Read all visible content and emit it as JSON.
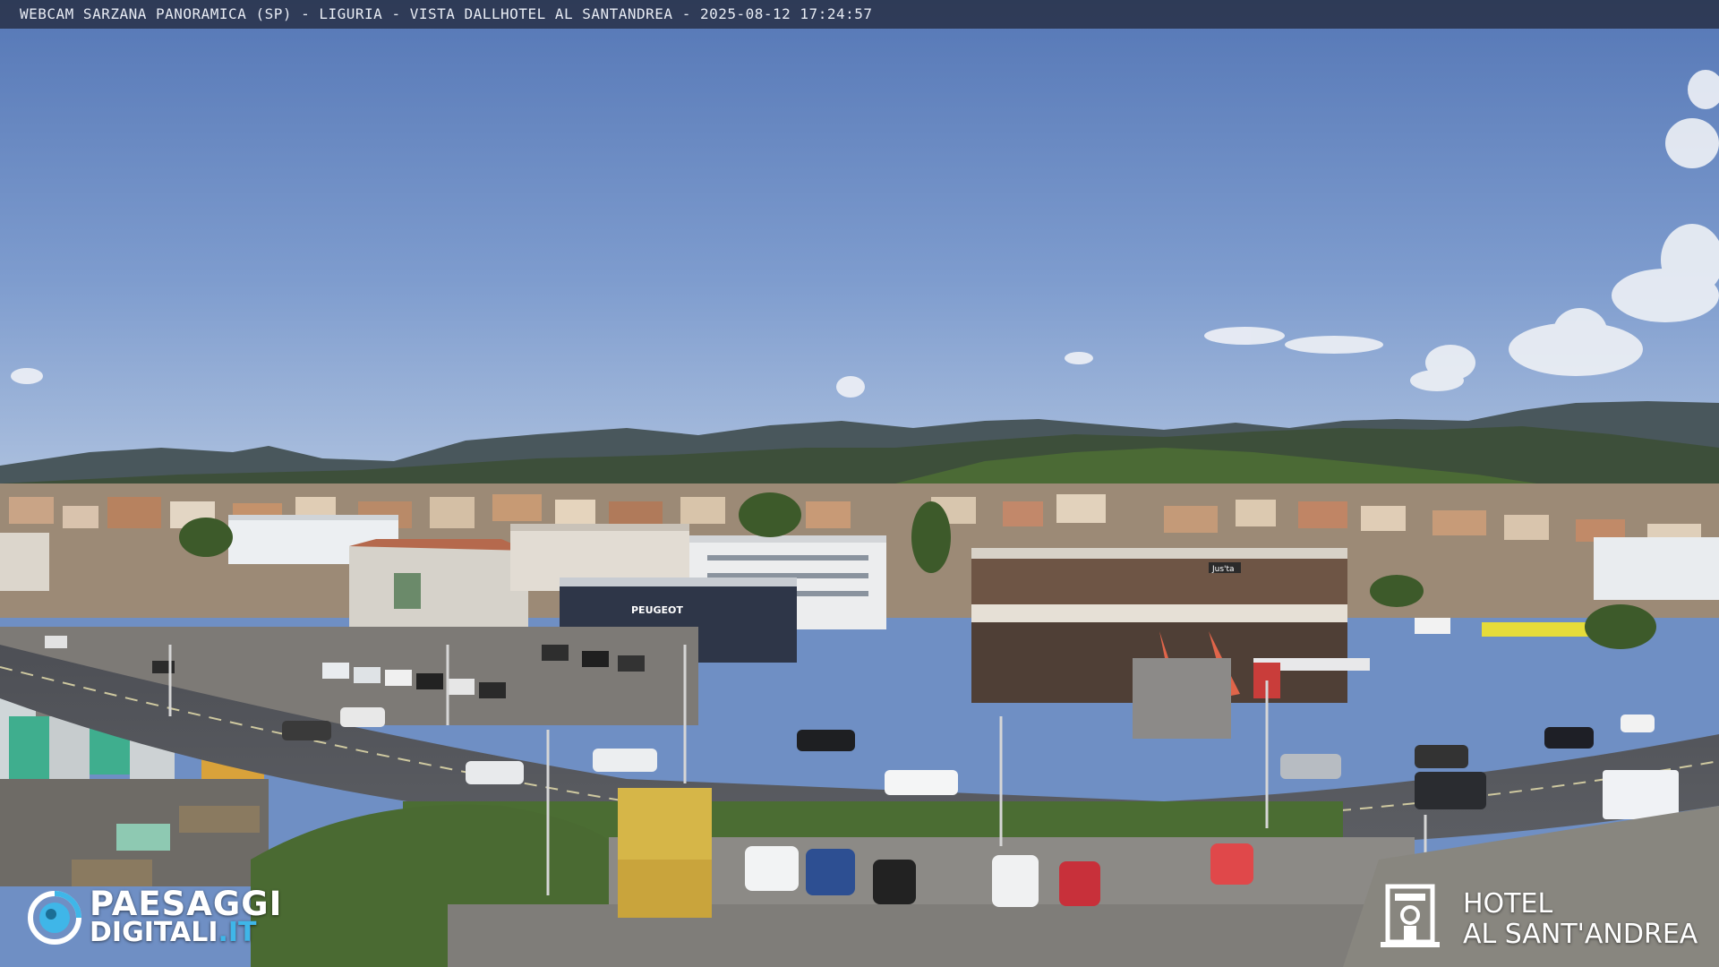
{
  "overlay": {
    "title": "WEBCAM SARZANA PANORAMICA (SP) - LIGURIA - VISTA DALLHOTEL AL SANTANDREA - 2025-08-12  17:24:57"
  },
  "logos": {
    "left_line1": "PAESAGGI",
    "left_line2_main": "DIGITALI",
    "left_line2_suffix": ".IT",
    "right_line1": "HOTEL",
    "right_line2": "AL SANT'ANDREA"
  },
  "signs": {
    "dealer": "PEUGEOT",
    "shop": "Jus'ta"
  },
  "colors": {
    "sky_top": "#5d80bd",
    "sky_bottom": "#9bb5da",
    "accent_logo": "#3fb6e8"
  },
  "scene": {
    "description_icon": "webcam-panorama-photo"
  }
}
